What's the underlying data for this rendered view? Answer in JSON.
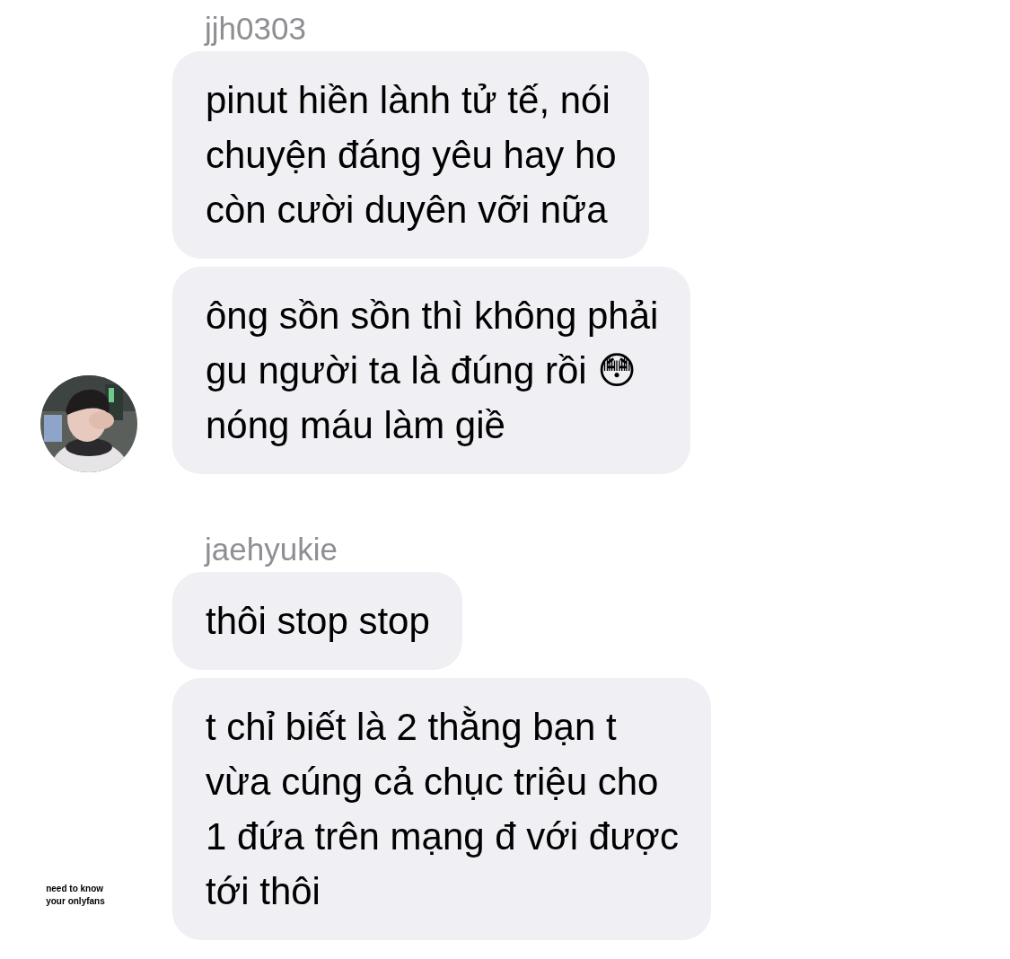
{
  "groups": [
    {
      "sender": "jjh0303",
      "messages": [
        "pinut hiền lành tử tế, nói\nchuyện đáng yêu hay ho\ncòn cười duyên vỡi nữa",
        "ông sồn sồn thì không phải\ngu người ta là đúng rồi 😳\nnóng máu làm giề"
      ]
    },
    {
      "sender": "jaehyukie",
      "side_note": "need to know\nyour onlyfans",
      "messages": [
        "thôi stop stop",
        "t chỉ biết là 2 thằng bạn t\nvừa cúng cả chục triệu cho\n1 đứa trên mạng đ với được\ntới thôi"
      ]
    }
  ]
}
